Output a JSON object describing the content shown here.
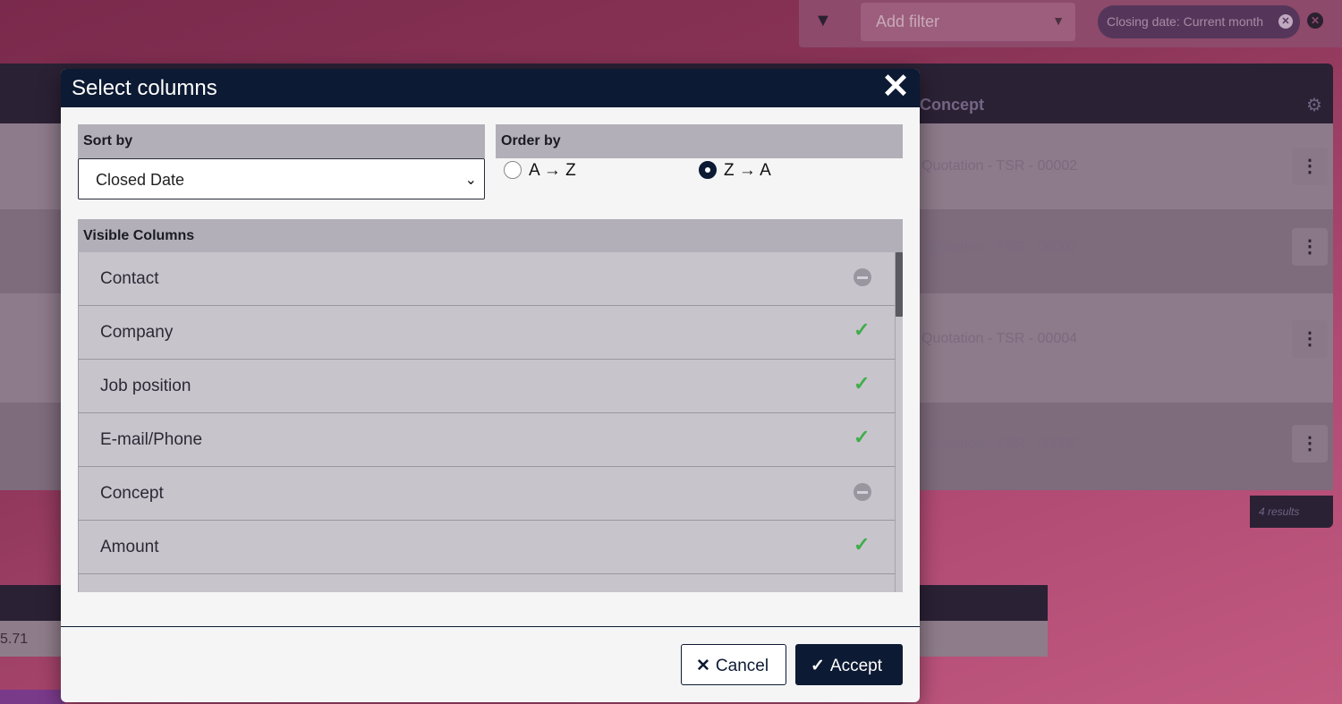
{
  "background": {
    "filter_placeholder": "Add filter",
    "active_filter": "Closing date: Current month",
    "table_header_concept": "Concept",
    "rows": [
      {
        "concept": "Quotation - TSR - 00002"
      },
      {
        "concept": "Quotation - TSR - 00003"
      },
      {
        "concept": "Quotation - TSR - 00004"
      },
      {
        "concept": "Quotation - TSR - 00005"
      }
    ],
    "results": "4 results",
    "footer_value": "5.71"
  },
  "modal": {
    "title": "Select columns",
    "sort_by_label": "Sort by",
    "sort_by_value": "Closed Date",
    "order_by_label": "Order by",
    "order_options": [
      {
        "label": "A → Z",
        "checked": false
      },
      {
        "label": "Z → A",
        "checked": true
      }
    ],
    "visible_columns_label": "Visible Columns",
    "columns": [
      {
        "label": "Contact",
        "visible": false
      },
      {
        "label": "Company",
        "visible": true
      },
      {
        "label": "Job position",
        "visible": true
      },
      {
        "label": "E-mail/Phone",
        "visible": true
      },
      {
        "label": "Concept",
        "visible": false
      },
      {
        "label": "Amount",
        "visible": true
      }
    ],
    "cancel_label": "Cancel",
    "accept_label": "Accept"
  },
  "colors": {
    "header_navy": "#0d1a33",
    "check_green": "#3fae4a",
    "section_gray": "#b3afb8"
  }
}
